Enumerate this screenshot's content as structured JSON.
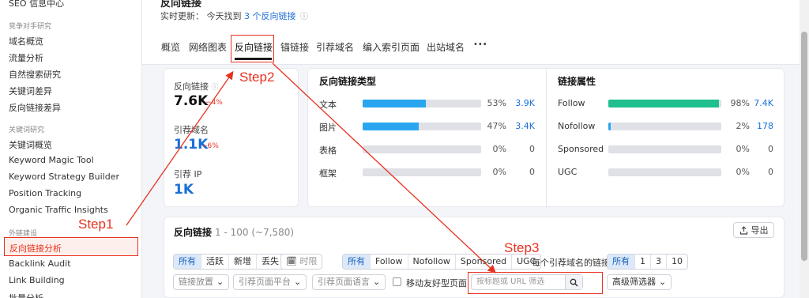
{
  "sidebar": {
    "seo_cut": "SEO 信息中心",
    "group_competitor": "竞争对手研究",
    "competitor_items": [
      "域名概览",
      "流量分析",
      "自然搜索研究",
      "关键词差异",
      "反向链接差异"
    ],
    "group_keyword": "关键词研究",
    "keyword_items": [
      "关键词概览",
      "Keyword Magic Tool",
      "Keyword Strategy Builder",
      "Position Tracking",
      "Organic Traffic Insights"
    ],
    "group_link": "外链建设",
    "link_active": "反向链接分析",
    "link_items": [
      "Backlink Audit",
      "Link Building",
      "批量分析"
    ]
  },
  "header": {
    "title_cut": "反向链接",
    "realtime_prefix": "实时更新：",
    "realtime_text": "今天找到",
    "realtime_link": "3 个反向链接",
    "tabs": [
      "概览",
      "网络图表",
      "反向链接",
      "锚链接",
      "引荐域名",
      "编入索引页面",
      "出站域名",
      "•••"
    ]
  },
  "summary": {
    "backlinks_label": "反向链接",
    "backlinks_value": "7.6K",
    "backlinks_delta": "−4%",
    "ref_domains_label": "引荐域名",
    "ref_domains_value": "1.1K",
    "ref_domains_delta": "−6%",
    "ref_ip_label": "引荐 IP",
    "ref_ip_value": "1K"
  },
  "breakdown": {
    "types_title": "反向链接类型",
    "types": [
      {
        "label": "文本",
        "pct": "53%",
        "count": "3.9K",
        "fraction": 0.53
      },
      {
        "label": "图片",
        "pct": "47%",
        "count": "3.4K",
        "fraction": 0.47
      },
      {
        "label": "表格",
        "pct": "0%",
        "count": "0",
        "fraction": 0
      },
      {
        "label": "框架",
        "pct": "0%",
        "count": "0",
        "fraction": 0
      }
    ],
    "attrs_title": "链接属性",
    "attrs": [
      {
        "label": "Follow",
        "pct": "98%",
        "count": "7.4K",
        "fraction": 0.98
      },
      {
        "label": "Nofollow",
        "pct": "2%",
        "count": "178",
        "fraction": 0.02
      },
      {
        "label": "Sponsored",
        "pct": "0%",
        "count": "0",
        "fraction": 0
      },
      {
        "label": "UGC",
        "pct": "0%",
        "count": "0",
        "fraction": 0
      }
    ],
    "colors": {
      "types_bar": "#2aa6f0",
      "follow_bar": "#1fbf8f",
      "nofollow_bar": "#2aa6f0",
      "count_link": "#1a6fd6"
    }
  },
  "table": {
    "title": "反向链接",
    "range": "1 - 100 (~7,580)",
    "export_label": "导出",
    "status_filters": [
      "所有",
      "活跃",
      "新增",
      "丢失"
    ],
    "time_label": "时限",
    "attr_filters": [
      "所有",
      "Follow",
      "Nofollow",
      "Sponsored",
      "UGC"
    ],
    "per_domain_label": "每个引荐域名的链接",
    "per_domain_filters": [
      "所有",
      "1",
      "3",
      "10"
    ],
    "dropdowns": [
      "链接放置",
      "引荐页面平台",
      "引荐页面语言"
    ],
    "mobile_label": "移动友好型页面",
    "search_placeholder": "按标题或 URL 筛选",
    "advanced_label": "高级筛选器"
  },
  "annotations": {
    "step1": "Step1",
    "step2": "Step2",
    "step3": "Step3"
  }
}
